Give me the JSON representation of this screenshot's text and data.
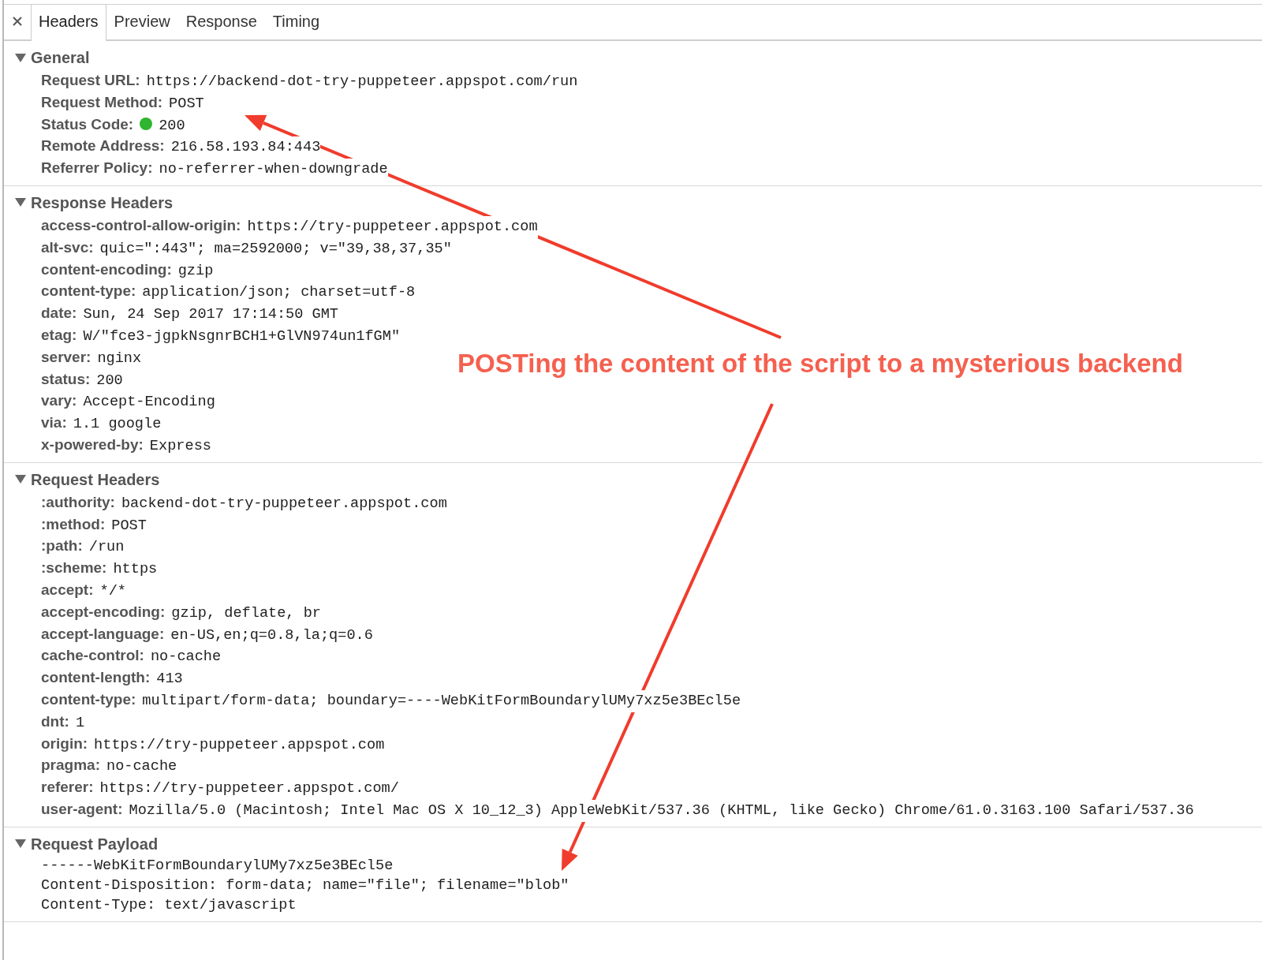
{
  "tabs": [
    {
      "label": "Headers",
      "selected": true
    },
    {
      "label": "Preview",
      "selected": false
    },
    {
      "label": "Response",
      "selected": false
    },
    {
      "label": "Timing",
      "selected": false
    }
  ],
  "sections": [
    {
      "title": "General",
      "expanded": true,
      "kind": "fields",
      "rows": [
        {
          "name": "Request URL:",
          "value": "https://backend-dot-try-puppeteer.appspot.com/run",
          "kind": "plain"
        },
        {
          "name": "Request Method:",
          "value": "POST",
          "kind": "plain"
        },
        {
          "name": "Status Code:",
          "value": "200",
          "kind": "status",
          "color": "#2fb52f"
        },
        {
          "name": "Remote Address:",
          "value": "216.58.193.84:443",
          "kind": "plain"
        },
        {
          "name": "Referrer Policy:",
          "value": "no-referrer-when-downgrade",
          "kind": "plain"
        }
      ]
    },
    {
      "title": "Response Headers",
      "expanded": true,
      "kind": "fields",
      "rows": [
        {
          "name": "access-control-allow-origin:",
          "value": "https://try-puppeteer.appspot.com",
          "kind": "plain"
        },
        {
          "name": "alt-svc:",
          "value": "quic=\":443\"; ma=2592000; v=\"39,38,37,35\"",
          "kind": "plain"
        },
        {
          "name": "content-encoding:",
          "value": "gzip",
          "kind": "plain"
        },
        {
          "name": "content-type:",
          "value": "application/json; charset=utf-8",
          "kind": "plain"
        },
        {
          "name": "date:",
          "value": "Sun, 24 Sep 2017 17:14:50 GMT",
          "kind": "plain"
        },
        {
          "name": "etag:",
          "value": "W/\"fce3-jgpkNsgnrBCH1+GlVN974un1fGM\"",
          "kind": "plain"
        },
        {
          "name": "server:",
          "value": "nginx",
          "kind": "plain"
        },
        {
          "name": "status:",
          "value": "200",
          "kind": "plain"
        },
        {
          "name": "vary:",
          "value": "Accept-Encoding",
          "kind": "plain"
        },
        {
          "name": "via:",
          "value": "1.1 google",
          "kind": "plain"
        },
        {
          "name": "x-powered-by:",
          "value": "Express",
          "kind": "plain"
        }
      ]
    },
    {
      "title": "Request Headers",
      "expanded": true,
      "kind": "fields",
      "rows": [
        {
          "name": ":authority:",
          "value": "backend-dot-try-puppeteer.appspot.com",
          "kind": "plain"
        },
        {
          "name": ":method:",
          "value": "POST",
          "kind": "plain"
        },
        {
          "name": ":path:",
          "value": "/run",
          "kind": "plain"
        },
        {
          "name": ":scheme:",
          "value": "https",
          "kind": "plain"
        },
        {
          "name": "accept:",
          "value": "*/*",
          "kind": "plain"
        },
        {
          "name": "accept-encoding:",
          "value": "gzip, deflate, br",
          "kind": "plain"
        },
        {
          "name": "accept-language:",
          "value": "en-US,en;q=0.8,la;q=0.6",
          "kind": "plain"
        },
        {
          "name": "cache-control:",
          "value": "no-cache",
          "kind": "plain"
        },
        {
          "name": "content-length:",
          "value": "413",
          "kind": "plain"
        },
        {
          "name": "content-type:",
          "value": "multipart/form-data; boundary=----WebKitFormBoundarylUMy7xz5e3BEcl5e",
          "kind": "plain"
        },
        {
          "name": "dnt:",
          "value": "1",
          "kind": "plain"
        },
        {
          "name": "origin:",
          "value": "https://try-puppeteer.appspot.com",
          "kind": "plain"
        },
        {
          "name": "pragma:",
          "value": "no-cache",
          "kind": "plain"
        },
        {
          "name": "referer:",
          "value": "https://try-puppeteer.appspot.com/",
          "kind": "plain"
        },
        {
          "name": "user-agent:",
          "value": "Mozilla/5.0 (Macintosh; Intel Mac OS X 10_12_3) AppleWebKit/537.36 (KHTML, like Gecko) Chrome/61.0.3163.100 Safari/537.36",
          "kind": "plain"
        }
      ]
    },
    {
      "title": "Request Payload",
      "expanded": true,
      "kind": "payload",
      "lines": [
        "------WebKitFormBoundarylUMy7xz5e3BEcl5e",
        "Content-Disposition: form-data; name=\"file\"; filename=\"blob\"",
        "Content-Type: text/javascript"
      ]
    }
  ],
  "annotation": {
    "text": "POSTing the content of the script to a mysterious backend"
  }
}
